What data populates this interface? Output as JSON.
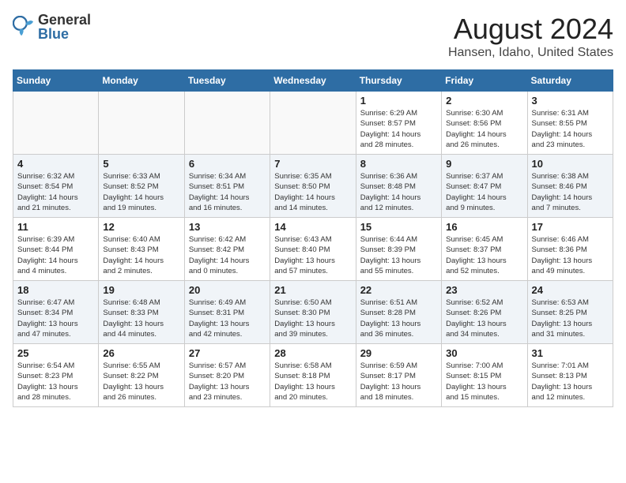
{
  "header": {
    "logo_general": "General",
    "logo_blue": "Blue",
    "month_year": "August 2024",
    "location": "Hansen, Idaho, United States"
  },
  "weekdays": [
    "Sunday",
    "Monday",
    "Tuesday",
    "Wednesday",
    "Thursday",
    "Friday",
    "Saturday"
  ],
  "weeks": [
    [
      {
        "day": "",
        "info": ""
      },
      {
        "day": "",
        "info": ""
      },
      {
        "day": "",
        "info": ""
      },
      {
        "day": "",
        "info": ""
      },
      {
        "day": "1",
        "info": "Sunrise: 6:29 AM\nSunset: 8:57 PM\nDaylight: 14 hours\nand 28 minutes."
      },
      {
        "day": "2",
        "info": "Sunrise: 6:30 AM\nSunset: 8:56 PM\nDaylight: 14 hours\nand 26 minutes."
      },
      {
        "day": "3",
        "info": "Sunrise: 6:31 AM\nSunset: 8:55 PM\nDaylight: 14 hours\nand 23 minutes."
      }
    ],
    [
      {
        "day": "4",
        "info": "Sunrise: 6:32 AM\nSunset: 8:54 PM\nDaylight: 14 hours\nand 21 minutes."
      },
      {
        "day": "5",
        "info": "Sunrise: 6:33 AM\nSunset: 8:52 PM\nDaylight: 14 hours\nand 19 minutes."
      },
      {
        "day": "6",
        "info": "Sunrise: 6:34 AM\nSunset: 8:51 PM\nDaylight: 14 hours\nand 16 minutes."
      },
      {
        "day": "7",
        "info": "Sunrise: 6:35 AM\nSunset: 8:50 PM\nDaylight: 14 hours\nand 14 minutes."
      },
      {
        "day": "8",
        "info": "Sunrise: 6:36 AM\nSunset: 8:48 PM\nDaylight: 14 hours\nand 12 minutes."
      },
      {
        "day": "9",
        "info": "Sunrise: 6:37 AM\nSunset: 8:47 PM\nDaylight: 14 hours\nand 9 minutes."
      },
      {
        "day": "10",
        "info": "Sunrise: 6:38 AM\nSunset: 8:46 PM\nDaylight: 14 hours\nand 7 minutes."
      }
    ],
    [
      {
        "day": "11",
        "info": "Sunrise: 6:39 AM\nSunset: 8:44 PM\nDaylight: 14 hours\nand 4 minutes."
      },
      {
        "day": "12",
        "info": "Sunrise: 6:40 AM\nSunset: 8:43 PM\nDaylight: 14 hours\nand 2 minutes."
      },
      {
        "day": "13",
        "info": "Sunrise: 6:42 AM\nSunset: 8:42 PM\nDaylight: 14 hours\nand 0 minutes."
      },
      {
        "day": "14",
        "info": "Sunrise: 6:43 AM\nSunset: 8:40 PM\nDaylight: 13 hours\nand 57 minutes."
      },
      {
        "day": "15",
        "info": "Sunrise: 6:44 AM\nSunset: 8:39 PM\nDaylight: 13 hours\nand 55 minutes."
      },
      {
        "day": "16",
        "info": "Sunrise: 6:45 AM\nSunset: 8:37 PM\nDaylight: 13 hours\nand 52 minutes."
      },
      {
        "day": "17",
        "info": "Sunrise: 6:46 AM\nSunset: 8:36 PM\nDaylight: 13 hours\nand 49 minutes."
      }
    ],
    [
      {
        "day": "18",
        "info": "Sunrise: 6:47 AM\nSunset: 8:34 PM\nDaylight: 13 hours\nand 47 minutes."
      },
      {
        "day": "19",
        "info": "Sunrise: 6:48 AM\nSunset: 8:33 PM\nDaylight: 13 hours\nand 44 minutes."
      },
      {
        "day": "20",
        "info": "Sunrise: 6:49 AM\nSunset: 8:31 PM\nDaylight: 13 hours\nand 42 minutes."
      },
      {
        "day": "21",
        "info": "Sunrise: 6:50 AM\nSunset: 8:30 PM\nDaylight: 13 hours\nand 39 minutes."
      },
      {
        "day": "22",
        "info": "Sunrise: 6:51 AM\nSunset: 8:28 PM\nDaylight: 13 hours\nand 36 minutes."
      },
      {
        "day": "23",
        "info": "Sunrise: 6:52 AM\nSunset: 8:26 PM\nDaylight: 13 hours\nand 34 minutes."
      },
      {
        "day": "24",
        "info": "Sunrise: 6:53 AM\nSunset: 8:25 PM\nDaylight: 13 hours\nand 31 minutes."
      }
    ],
    [
      {
        "day": "25",
        "info": "Sunrise: 6:54 AM\nSunset: 8:23 PM\nDaylight: 13 hours\nand 28 minutes."
      },
      {
        "day": "26",
        "info": "Sunrise: 6:55 AM\nSunset: 8:22 PM\nDaylight: 13 hours\nand 26 minutes."
      },
      {
        "day": "27",
        "info": "Sunrise: 6:57 AM\nSunset: 8:20 PM\nDaylight: 13 hours\nand 23 minutes."
      },
      {
        "day": "28",
        "info": "Sunrise: 6:58 AM\nSunset: 8:18 PM\nDaylight: 13 hours\nand 20 minutes."
      },
      {
        "day": "29",
        "info": "Sunrise: 6:59 AM\nSunset: 8:17 PM\nDaylight: 13 hours\nand 18 minutes."
      },
      {
        "day": "30",
        "info": "Sunrise: 7:00 AM\nSunset: 8:15 PM\nDaylight: 13 hours\nand 15 minutes."
      },
      {
        "day": "31",
        "info": "Sunrise: 7:01 AM\nSunset: 8:13 PM\nDaylight: 13 hours\nand 12 minutes."
      }
    ]
  ]
}
